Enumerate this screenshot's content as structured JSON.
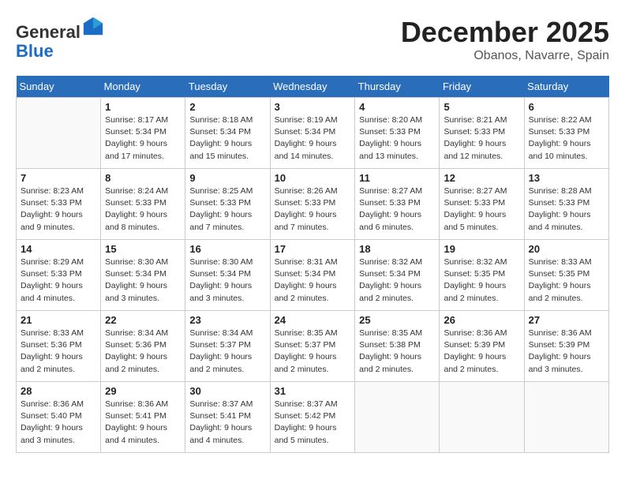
{
  "header": {
    "logo_general": "General",
    "logo_blue": "Blue",
    "month": "December 2025",
    "location": "Obanos, Navarre, Spain"
  },
  "weekdays": [
    "Sunday",
    "Monday",
    "Tuesday",
    "Wednesday",
    "Thursday",
    "Friday",
    "Saturday"
  ],
  "weeks": [
    [
      {
        "day": "",
        "info": ""
      },
      {
        "day": "1",
        "info": "Sunrise: 8:17 AM\nSunset: 5:34 PM\nDaylight: 9 hours\nand 17 minutes."
      },
      {
        "day": "2",
        "info": "Sunrise: 8:18 AM\nSunset: 5:34 PM\nDaylight: 9 hours\nand 15 minutes."
      },
      {
        "day": "3",
        "info": "Sunrise: 8:19 AM\nSunset: 5:34 PM\nDaylight: 9 hours\nand 14 minutes."
      },
      {
        "day": "4",
        "info": "Sunrise: 8:20 AM\nSunset: 5:33 PM\nDaylight: 9 hours\nand 13 minutes."
      },
      {
        "day": "5",
        "info": "Sunrise: 8:21 AM\nSunset: 5:33 PM\nDaylight: 9 hours\nand 12 minutes."
      },
      {
        "day": "6",
        "info": "Sunrise: 8:22 AM\nSunset: 5:33 PM\nDaylight: 9 hours\nand 10 minutes."
      }
    ],
    [
      {
        "day": "7",
        "info": "Sunrise: 8:23 AM\nSunset: 5:33 PM\nDaylight: 9 hours\nand 9 minutes."
      },
      {
        "day": "8",
        "info": "Sunrise: 8:24 AM\nSunset: 5:33 PM\nDaylight: 9 hours\nand 8 minutes."
      },
      {
        "day": "9",
        "info": "Sunrise: 8:25 AM\nSunset: 5:33 PM\nDaylight: 9 hours\nand 7 minutes."
      },
      {
        "day": "10",
        "info": "Sunrise: 8:26 AM\nSunset: 5:33 PM\nDaylight: 9 hours\nand 7 minutes."
      },
      {
        "day": "11",
        "info": "Sunrise: 8:27 AM\nSunset: 5:33 PM\nDaylight: 9 hours\nand 6 minutes."
      },
      {
        "day": "12",
        "info": "Sunrise: 8:27 AM\nSunset: 5:33 PM\nDaylight: 9 hours\nand 5 minutes."
      },
      {
        "day": "13",
        "info": "Sunrise: 8:28 AM\nSunset: 5:33 PM\nDaylight: 9 hours\nand 4 minutes."
      }
    ],
    [
      {
        "day": "14",
        "info": "Sunrise: 8:29 AM\nSunset: 5:33 PM\nDaylight: 9 hours\nand 4 minutes."
      },
      {
        "day": "15",
        "info": "Sunrise: 8:30 AM\nSunset: 5:34 PM\nDaylight: 9 hours\nand 3 minutes."
      },
      {
        "day": "16",
        "info": "Sunrise: 8:30 AM\nSunset: 5:34 PM\nDaylight: 9 hours\nand 3 minutes."
      },
      {
        "day": "17",
        "info": "Sunrise: 8:31 AM\nSunset: 5:34 PM\nDaylight: 9 hours\nand 2 minutes."
      },
      {
        "day": "18",
        "info": "Sunrise: 8:32 AM\nSunset: 5:34 PM\nDaylight: 9 hours\nand 2 minutes."
      },
      {
        "day": "19",
        "info": "Sunrise: 8:32 AM\nSunset: 5:35 PM\nDaylight: 9 hours\nand 2 minutes."
      },
      {
        "day": "20",
        "info": "Sunrise: 8:33 AM\nSunset: 5:35 PM\nDaylight: 9 hours\nand 2 minutes."
      }
    ],
    [
      {
        "day": "21",
        "info": "Sunrise: 8:33 AM\nSunset: 5:36 PM\nDaylight: 9 hours\nand 2 minutes."
      },
      {
        "day": "22",
        "info": "Sunrise: 8:34 AM\nSunset: 5:36 PM\nDaylight: 9 hours\nand 2 minutes."
      },
      {
        "day": "23",
        "info": "Sunrise: 8:34 AM\nSunset: 5:37 PM\nDaylight: 9 hours\nand 2 minutes."
      },
      {
        "day": "24",
        "info": "Sunrise: 8:35 AM\nSunset: 5:37 PM\nDaylight: 9 hours\nand 2 minutes."
      },
      {
        "day": "25",
        "info": "Sunrise: 8:35 AM\nSunset: 5:38 PM\nDaylight: 9 hours\nand 2 minutes."
      },
      {
        "day": "26",
        "info": "Sunrise: 8:36 AM\nSunset: 5:39 PM\nDaylight: 9 hours\nand 2 minutes."
      },
      {
        "day": "27",
        "info": "Sunrise: 8:36 AM\nSunset: 5:39 PM\nDaylight: 9 hours\nand 3 minutes."
      }
    ],
    [
      {
        "day": "28",
        "info": "Sunrise: 8:36 AM\nSunset: 5:40 PM\nDaylight: 9 hours\nand 3 minutes."
      },
      {
        "day": "29",
        "info": "Sunrise: 8:36 AM\nSunset: 5:41 PM\nDaylight: 9 hours\nand 4 minutes."
      },
      {
        "day": "30",
        "info": "Sunrise: 8:37 AM\nSunset: 5:41 PM\nDaylight: 9 hours\nand 4 minutes."
      },
      {
        "day": "31",
        "info": "Sunrise: 8:37 AM\nSunset: 5:42 PM\nDaylight: 9 hours\nand 5 minutes."
      },
      {
        "day": "",
        "info": ""
      },
      {
        "day": "",
        "info": ""
      },
      {
        "day": "",
        "info": ""
      }
    ]
  ]
}
